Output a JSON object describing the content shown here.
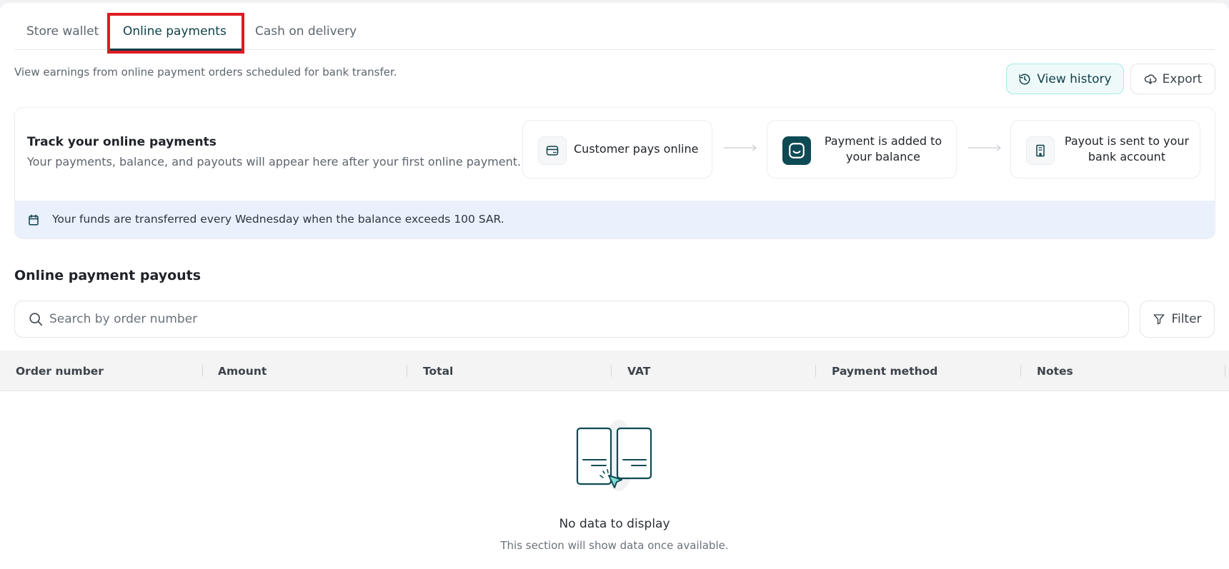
{
  "tabs": {
    "store_wallet": "Store wallet",
    "online_payments": "Online payments",
    "cash_on_delivery": "Cash on delivery"
  },
  "subtitle": "View earnings from online payment orders scheduled for bank transfer.",
  "actions": {
    "view_history": "View history",
    "export": "Export"
  },
  "track": {
    "title": "Track your online payments",
    "description": "Your payments, balance, and payouts will appear here after your first online payment.",
    "steps": [
      {
        "label": "Customer pays online",
        "icon": "card-icon"
      },
      {
        "label": "Payment is added to your balance",
        "icon": "wallet-brand-icon"
      },
      {
        "label": "Payout is sent to your bank account",
        "icon": "bank-building-icon"
      }
    ],
    "info": "Your funds are transferred every Wednesday when the balance exceeds 100 SAR."
  },
  "payouts": {
    "title": "Online payment payouts",
    "search_placeholder": "Search by order number",
    "filter": "Filter",
    "columns": [
      "Order number",
      "Amount",
      "Total",
      "VAT",
      "Payment method",
      "Notes"
    ]
  },
  "empty": {
    "title": "No data to display",
    "subtitle": "This section will show data once available."
  },
  "colors": {
    "brand": "#0e3f4a",
    "highlight": "#e01b22",
    "info_bg": "#eaf1fc",
    "accent_teal": "#a6ebe6"
  }
}
